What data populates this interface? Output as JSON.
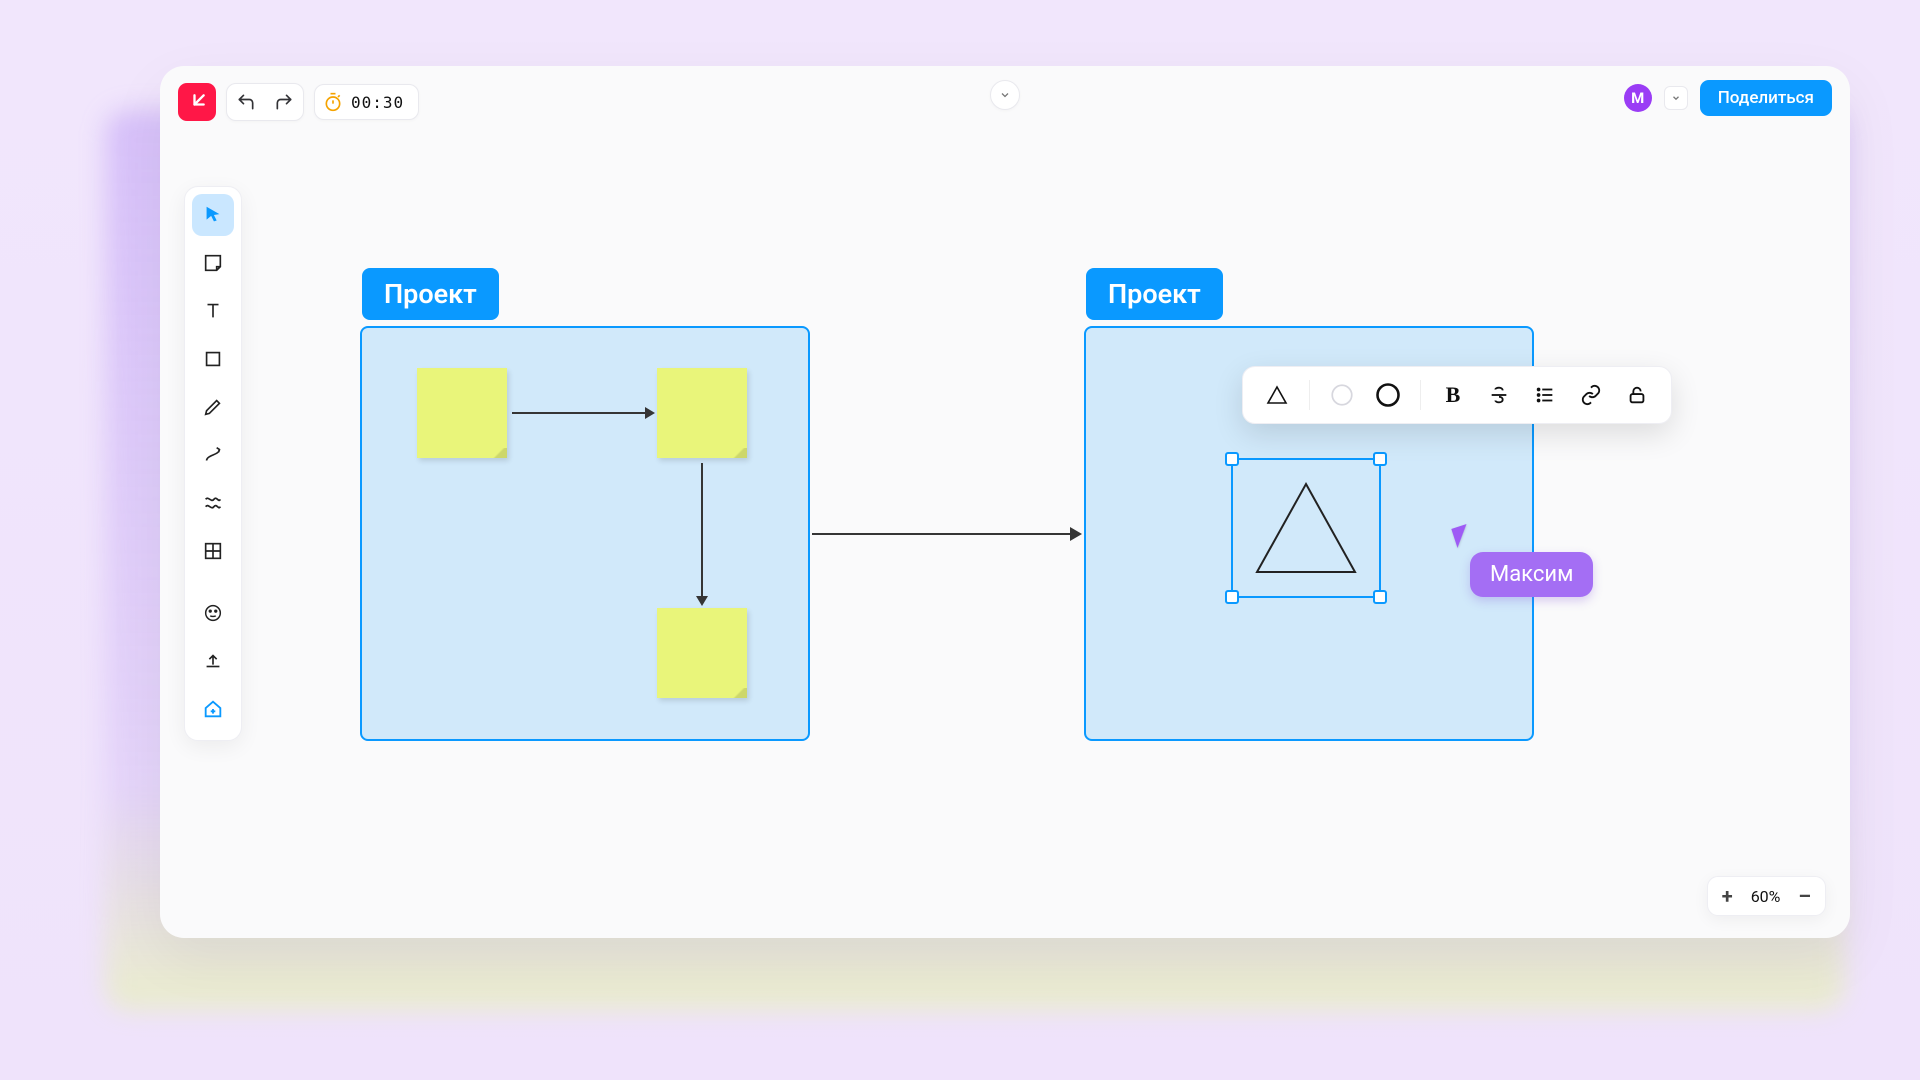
{
  "header": {
    "timer_value": "00:30",
    "share_label": "Поделиться",
    "avatar_initial": "М"
  },
  "toolbar": {
    "tools": [
      "select",
      "sticky-note",
      "text",
      "shape",
      "pen",
      "connector",
      "scribble",
      "grid",
      "sticker",
      "upload",
      "add-home"
    ]
  },
  "canvas": {
    "frames": [
      {
        "id": "frame-1",
        "label": "Проект"
      },
      {
        "id": "frame-2",
        "label": "Проект"
      }
    ],
    "remote_user": {
      "name": "Максим"
    }
  },
  "context_toolbar": {
    "shape_options": [
      "triangle",
      "circle-outline",
      "circle-thick"
    ],
    "text_options": [
      "bold",
      "strikethrough",
      "list",
      "link",
      "lock"
    ],
    "bold_letter": "B"
  },
  "zoom": {
    "value": "60%",
    "plus": "+",
    "minus": "–"
  }
}
